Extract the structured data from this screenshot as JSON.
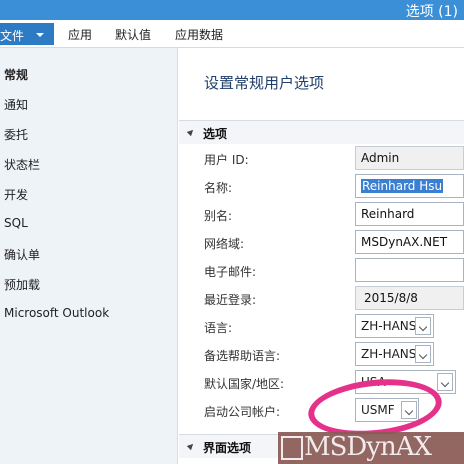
{
  "window": {
    "title": "选项 (1)"
  },
  "menu": {
    "file_label": "文件",
    "tabs": [
      "应用",
      "默认值",
      "应用数据"
    ]
  },
  "sidebar": {
    "items": [
      {
        "label": "常规",
        "active": true
      },
      {
        "label": "通知"
      },
      {
        "label": "委托"
      },
      {
        "label": "状态栏"
      },
      {
        "label": "开发"
      },
      {
        "label": "SQL"
      },
      {
        "label": "确认单"
      },
      {
        "label": "预加载"
      },
      {
        "label": "Microsoft Outlook"
      }
    ]
  },
  "main": {
    "title": "设置常规用户选项",
    "section_options": "选项",
    "section_interface": "界面选项",
    "fields": {
      "user_id": {
        "label": "用户 ID:",
        "value": "Admin"
      },
      "name": {
        "label": "名称:",
        "value": "Reinhard Hsu"
      },
      "alias": {
        "label": "别名:",
        "value": "Reinhard"
      },
      "network_domain": {
        "label": "网络域:",
        "value": "MSDynAX.NET"
      },
      "email": {
        "label": "电子邮件:",
        "value": ""
      },
      "last_login": {
        "label": "最近登录:",
        "value": "2015/8/8"
      },
      "language": {
        "label": "语言:",
        "value": "ZH-HANS"
      },
      "help_language": {
        "label": "备选帮助语言:",
        "value": "ZH-HANS"
      },
      "country_region": {
        "label": "默认国家/地区:",
        "value": "USA"
      },
      "startup_company": {
        "label": "启动公司帐户:",
        "value": "USMF"
      }
    }
  },
  "watermark": {
    "text": "MSDynAX"
  },
  "colors": {
    "accent": "#3b8fd6",
    "file_menu": "#2d7bc4",
    "highlight_ring": "#e5318a",
    "selection": "#3b7fd1"
  }
}
